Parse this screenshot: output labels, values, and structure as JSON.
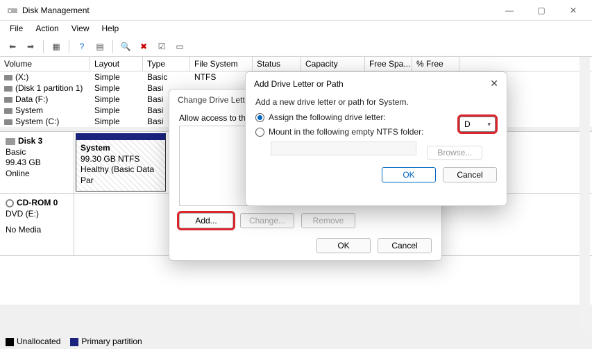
{
  "window": {
    "title": "Disk Management",
    "min": "—",
    "max": "▢",
    "close": "✕"
  },
  "menu": [
    "File",
    "Action",
    "View",
    "Help"
  ],
  "columns": [
    "Volume",
    "Layout",
    "Type",
    "File System",
    "Status",
    "Capacity",
    "Free Spa...",
    "% Free"
  ],
  "volumes": [
    {
      "name": "(X:)",
      "layout": "Simple",
      "type": "Basic",
      "fs": "NTFS"
    },
    {
      "name": "(Disk 1 partition 1)",
      "layout": "Simple",
      "type": "Basi"
    },
    {
      "name": "Data (F:)",
      "layout": "Simple",
      "type": "Basi"
    },
    {
      "name": "System",
      "layout": "Simple",
      "type": "Basi"
    },
    {
      "name": "System (C:)",
      "layout": "Simple",
      "type": "Basi"
    }
  ],
  "disks": {
    "d3": {
      "title": "Disk 3",
      "type": "Basic",
      "size": "99.43 GB",
      "status": "Online",
      "part": {
        "name": "System",
        "info": "99.30 GB NTFS",
        "state": "Healthy (Basic Data Par"
      }
    },
    "cd": {
      "title": "CD-ROM 0",
      "sub": "DVD (E:)",
      "status": "No Media"
    }
  },
  "legend": {
    "unalloc": "Unallocated",
    "primary": "Primary partition"
  },
  "dialog1": {
    "title": "Change Drive Lette",
    "msg": "Allow access to this v",
    "add": "Add...",
    "change": "Change...",
    "remove": "Remove",
    "ok": "OK",
    "cancel": "Cancel"
  },
  "dialog2": {
    "title": "Add Drive Letter or Path",
    "msg": "Add a new drive letter or path for System.",
    "opt1": "Assign the following drive letter:",
    "opt2": "Mount in the following empty NTFS folder:",
    "letter": "D",
    "browse": "Browse...",
    "ok": "OK",
    "cancel": "Cancel"
  }
}
